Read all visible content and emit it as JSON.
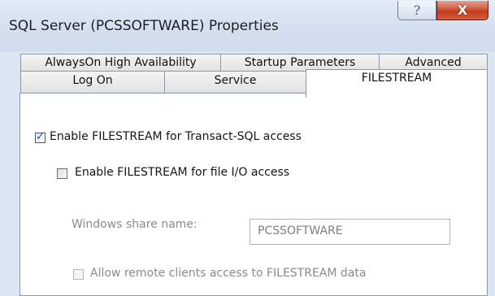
{
  "window": {
    "title": "SQL Server (PCSSOFTWARE) Properties",
    "help_glyph": "?",
    "close_glyph": "X"
  },
  "tabs": {
    "row1": [
      {
        "label": "AlwaysOn High Availability"
      },
      {
        "label": "Startup Parameters"
      },
      {
        "label": "Advanced"
      }
    ],
    "row2": [
      {
        "label": "Log On"
      },
      {
        "label": "Service"
      },
      {
        "label": "FILESTREAM",
        "active": true
      }
    ]
  },
  "filestream": {
    "enable_tsql": {
      "label": "Enable FILESTREAM for Transact-SQL access",
      "checked": true,
      "check_glyph": "✓"
    },
    "enable_file_io": {
      "label": "Enable FILESTREAM for file I/O access",
      "checked": false
    },
    "share_name": {
      "label": "Windows share name:",
      "value": "PCSSOFTWARE",
      "enabled": false
    },
    "remote_clients": {
      "label": "Allow remote clients access to FILESTREAM data",
      "checked": false,
      "enabled": false
    }
  }
}
